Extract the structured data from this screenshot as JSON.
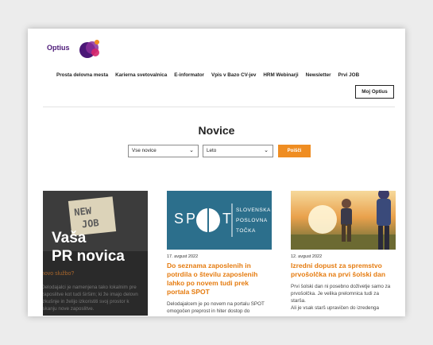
{
  "brand": {
    "name": "Optius",
    "accent": "#ef8d22",
    "purple": "#4b1877"
  },
  "nav": [
    {
      "label": "Prosta delovna mesta"
    },
    {
      "label": "Karierna svetovalnica"
    },
    {
      "label": "E-informator"
    },
    {
      "label": "Vpis v Bazo CV-jev"
    },
    {
      "label": "HRM Webinarji"
    },
    {
      "label": "Newsletter"
    },
    {
      "label": "Prvi JOB"
    }
  ],
  "account_button": "Moj Optius",
  "page_title": "Novice",
  "filters": {
    "category": "Vse novice",
    "year": "Leto",
    "search_button": "Poišči"
  },
  "cards": [
    {
      "promo_line1": "Vaša",
      "promo_line2": "PR novica",
      "note_line1": "NEW",
      "note_line2": "JOB",
      "ghost_title": "novo službo?",
      "ghost_text": [
        "Delodajalci je namenjena tako lokalnim pre",
        "zaposlitve kot tudi širšim; ki že imajo delovn",
        "izkušnje in želijo izkoristiti svoj prostor k",
        "iskanju nove zaposlitve."
      ]
    },
    {
      "logo_letters": [
        "S",
        "P",
        "O",
        "T"
      ],
      "logo_text": [
        "SLOVENSKA",
        "POSLOVNA",
        "TOČKA"
      ],
      "date": "17. avgust 2022",
      "title": "Do seznama zaposlenih in potrdila o številu zaposlenih lahko po novem tudi prek portala SPOT",
      "text": [
        "Delodajalcem je po novem na portalu SPOT",
        "omogočen preprost in hiter dostop do"
      ]
    },
    {
      "date": "12. avgust 2022",
      "title": "Izredni dopust za spremstvo prvošolčka na prvi šolski dan",
      "text": [
        "Prvi šolski dan ni posebno doživetje samo za",
        "prvošolčka. Je velika prelomnica tudi za",
        "starša.",
        "Ali je vsak starš upravičen do izredenga"
      ]
    }
  ]
}
